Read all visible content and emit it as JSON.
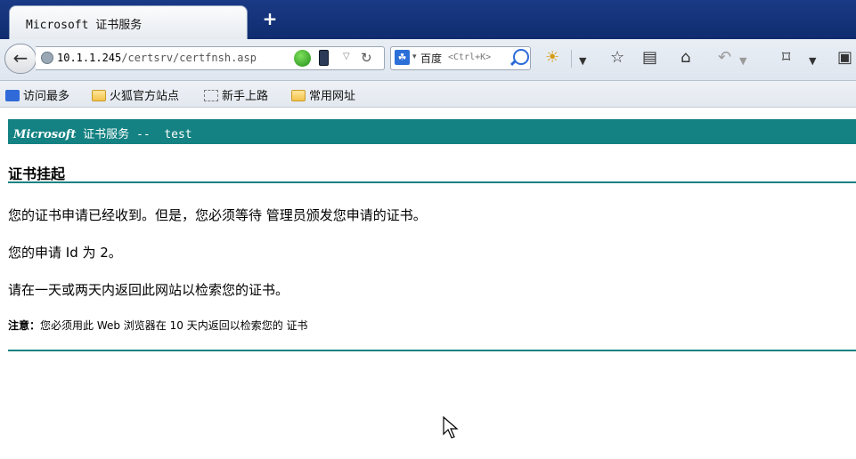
{
  "browser": {
    "tab_title": "Microsoft 证书服务",
    "new_tab_label": "+",
    "url_host": "10.1.1.245",
    "url_path": "/certsrv/certfnsh.asp",
    "search_engine_label": "百度",
    "search_placeholder": "<Ctrl+K>"
  },
  "bookmarks": [
    {
      "label": "访问最多"
    },
    {
      "label": "火狐官方站点"
    },
    {
      "label": "新手上路"
    },
    {
      "label": "常用网址"
    }
  ],
  "page": {
    "banner_brand": "Microsoft",
    "banner_rest": " 证书服务 --  test",
    "heading": "证书挂起",
    "para1": "您的证书申请已经收到。但是，您必须等待 管理员颁发您申请的证书。",
    "para2": "您的申请 Id 为 2。",
    "para3": "请在一天或两天内返回此网站以检索您的证书。",
    "note_label": "注意：",
    "note_text": "您必须用此 Web 浏览器在 10 天内返回以检索您的 证书"
  },
  "colors": {
    "accent": "#148282",
    "titlebar": "#1a3a86"
  }
}
